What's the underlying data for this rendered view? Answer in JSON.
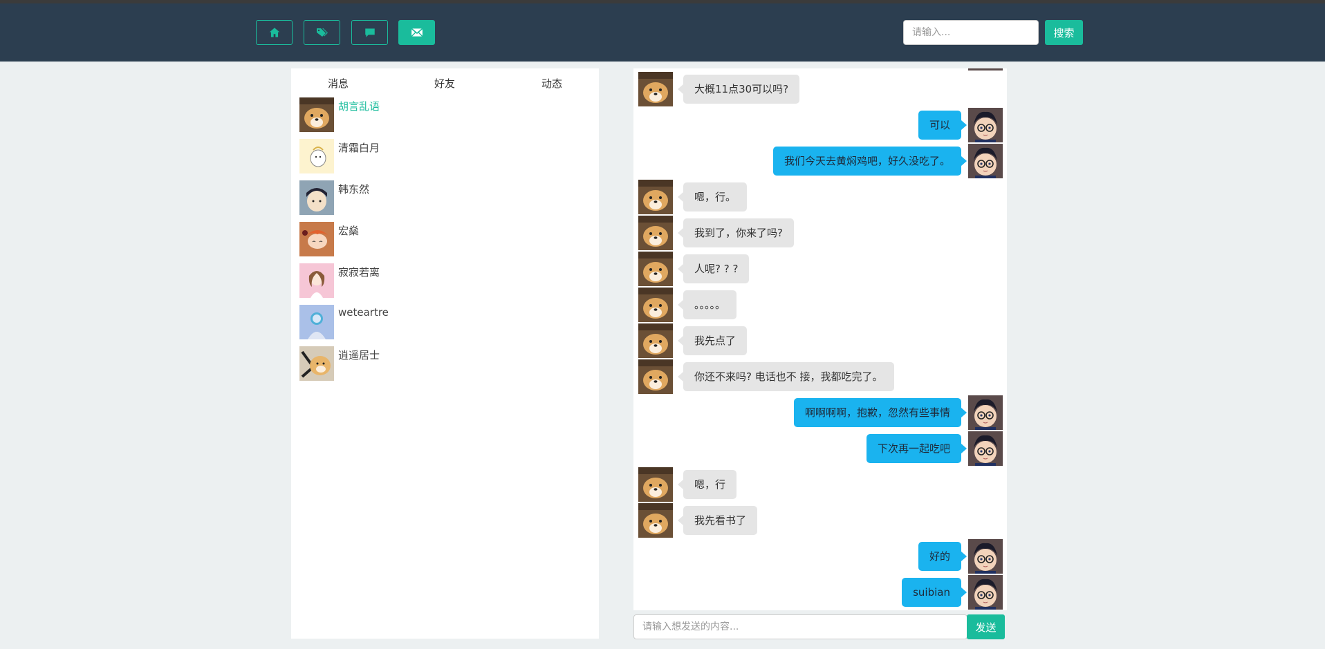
{
  "nav": {
    "buttons": [
      {
        "icon": "home-icon"
      },
      {
        "icon": "tags-icon"
      },
      {
        "icon": "comment-icon"
      },
      {
        "icon": "envelope-icon",
        "active": true
      }
    ],
    "search_placeholder": "请输入...",
    "search_label": "搜索"
  },
  "tabs": [
    "消息",
    "好友",
    "动态"
  ],
  "contacts": [
    {
      "name": "胡言乱语",
      "active": true
    },
    {
      "name": "清霜白月"
    },
    {
      "name": "韩东然"
    },
    {
      "name": "宏燊"
    },
    {
      "name": "寂寂若离"
    },
    {
      "name": "weteartre"
    },
    {
      "name": "逍遥居士"
    }
  ],
  "messages": [
    {
      "side": "left",
      "text": "大概11点30可以吗?"
    },
    {
      "side": "right",
      "text": "可以"
    },
    {
      "side": "right",
      "text": "我们今天去黄焖鸡吧，好久没吃了。"
    },
    {
      "side": "left",
      "text": "嗯，行。"
    },
    {
      "side": "left",
      "text": "我到了，你来了吗?"
    },
    {
      "side": "left",
      "text": "人呢? ? ?"
    },
    {
      "side": "left",
      "text": "。。。。。"
    },
    {
      "side": "left",
      "text": "我先点了"
    },
    {
      "side": "left",
      "text": "你还不来吗? 电话也不 接，我都吃完了。"
    },
    {
      "side": "right",
      "text": "啊啊啊啊，抱歉，忽然有些事情"
    },
    {
      "side": "right",
      "text": "下次再一起吃吧"
    },
    {
      "side": "left",
      "text": "嗯，行"
    },
    {
      "side": "left",
      "text": "我先看书了"
    },
    {
      "side": "right",
      "text": "好的"
    },
    {
      "side": "right",
      "text": "suibian"
    }
  ],
  "composer": {
    "placeholder": "请输入想发送的内容...",
    "send_label": "发送"
  },
  "colors": {
    "navbar": "#2c3e50",
    "accent": "#1abc9c",
    "own_bubble": "#1ab3ef",
    "other_bubble": "#e5e5e5",
    "background": "#ecf0f1"
  }
}
